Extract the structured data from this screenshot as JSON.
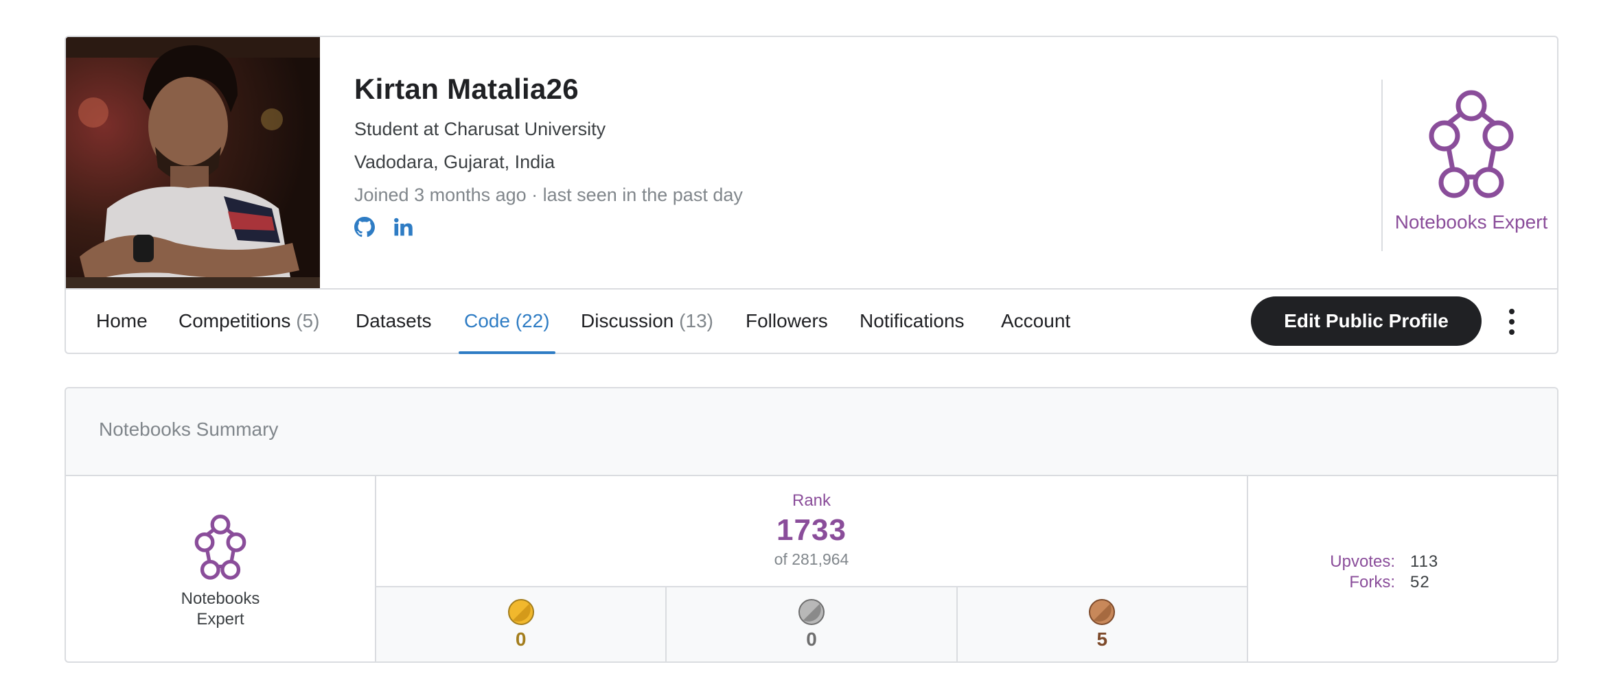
{
  "profile": {
    "name": "Kirtan Matalia26",
    "occupation": "Student at Charusat University",
    "location": "Vadodara, Gujarat, India",
    "activity": "Joined 3 months ago · last seen in the past day",
    "socials": [
      "github-icon",
      "linkedin-icon"
    ],
    "tier_label": "Notebooks Expert",
    "accent_color": "#8a4d9a"
  },
  "tabs": [
    {
      "label": "Home",
      "count": ""
    },
    {
      "label": "Competitions",
      "count": "(5)"
    },
    {
      "label": "Datasets",
      "count": ""
    },
    {
      "label": "Code",
      "count": "(22)",
      "active": true
    },
    {
      "label": "Discussion",
      "count": "(13)"
    },
    {
      "label": "Followers",
      "count": ""
    },
    {
      "label": "Notifications",
      "count": ""
    },
    {
      "label": "Account",
      "count": ""
    }
  ],
  "actions": {
    "edit_profile": "Edit Public Profile",
    "more_icon": "kebab-menu-icon"
  },
  "summary": {
    "title": "Notebooks Summary",
    "tier_line1": "Notebooks",
    "tier_line2": "Expert",
    "rank_label": "Rank",
    "rank_value": "1733",
    "rank_of": "of 281,964",
    "medals": [
      {
        "type": "gold",
        "count": "0",
        "color": "#a37d1c"
      },
      {
        "type": "silver",
        "count": "0",
        "color": "#6e6e6e"
      },
      {
        "type": "bronze",
        "count": "5",
        "color": "#7d4a2a"
      }
    ],
    "upvotes_label": "Upvotes:",
    "upvotes_value": "113",
    "forks_label": "Forks:",
    "forks_value": "52"
  }
}
